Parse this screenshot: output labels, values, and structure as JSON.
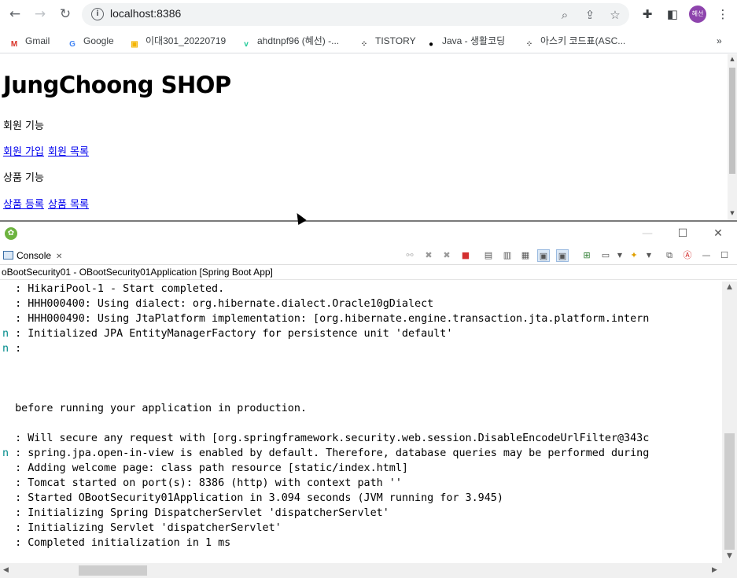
{
  "browser": {
    "url": "localhost:8386",
    "avatar_text": "혜선",
    "bookmarks": [
      {
        "label": "Gmail",
        "icon": "gmail-icon",
        "icon_glyph": "M",
        "color": "#d93025"
      },
      {
        "label": "Google",
        "icon": "google-icon",
        "icon_glyph": "G",
        "color": "#4285f4"
      },
      {
        "label": "이대301_20220719",
        "icon": "classroom-icon",
        "icon_glyph": "▣",
        "color": "#f4b400"
      },
      {
        "label": "ahdtnpf96 (혜선) -...",
        "icon": "velog-icon",
        "icon_glyph": "v",
        "color": "#20c997"
      },
      {
        "label": "TISTORY",
        "icon": "tistory-icon",
        "icon_glyph": "⁘",
        "color": "#333333"
      },
      {
        "label": "Java - 생활코딩",
        "icon": "opentutorials-icon",
        "icon_glyph": "●",
        "color": "#000000"
      },
      {
        "label": "아스키 코드표(ASC...",
        "icon": "tistory-icon",
        "icon_glyph": "⁘",
        "color": "#333333"
      }
    ]
  },
  "webpage": {
    "title": "JungChoong SHOP",
    "member_heading": "회원 기능",
    "member_links": [
      "회원 가입",
      "회원 목록"
    ],
    "product_heading": "상품 기능",
    "product_links": [
      "상품 등록",
      "상품 목록"
    ]
  },
  "eclipse": {
    "console_tab_label": "Console",
    "launch_label": "oBootSecurity01 - OBootSecurity01Application [Spring Boot App]",
    "lines": [
      {
        "prefix": " ",
        "text": ": HikariPool-1 - Start completed."
      },
      {
        "prefix": " ",
        "text": ": HHH000400: Using dialect: org.hibernate.dialect.Oracle10gDialect"
      },
      {
        "prefix": " ",
        "text": ": HHH000490: Using JtaPlatform implementation: [org.hibernate.engine.transaction.jta.platform.intern"
      },
      {
        "prefix": "n",
        "text": ": Initialized JPA EntityManagerFactory for persistence unit 'default'"
      },
      {
        "prefix": "n",
        "text": ":"
      },
      {
        "prefix": "",
        "text": ""
      },
      {
        "prefix": "",
        "text": ""
      },
      {
        "prefix": "",
        "text": ""
      },
      {
        "prefix": "",
        "text": " before running your application in production."
      },
      {
        "prefix": "",
        "text": ""
      },
      {
        "prefix": " ",
        "text": ": Will secure any request with [org.springframework.security.web.session.DisableEncodeUrlFilter@343c"
      },
      {
        "prefix": "n",
        "text": ": spring.jpa.open-in-view is enabled by default. Therefore, database queries may be performed during"
      },
      {
        "prefix": " ",
        "text": ": Adding welcome page: class path resource [static/index.html]"
      },
      {
        "prefix": " ",
        "text": ": Tomcat started on port(s): 8386 (http) with context path ''"
      },
      {
        "prefix": " ",
        "text": ": Started OBootSecurity01Application in 3.094 seconds (JVM running for 3.945)"
      },
      {
        "prefix": " ",
        "text": ": Initializing Spring DispatcherServlet 'dispatcherServlet'"
      },
      {
        "prefix": " ",
        "text": ": Initializing Servlet 'dispatcherServlet'"
      },
      {
        "prefix": " ",
        "text": ": Completed initialization in 1 ms"
      }
    ]
  }
}
